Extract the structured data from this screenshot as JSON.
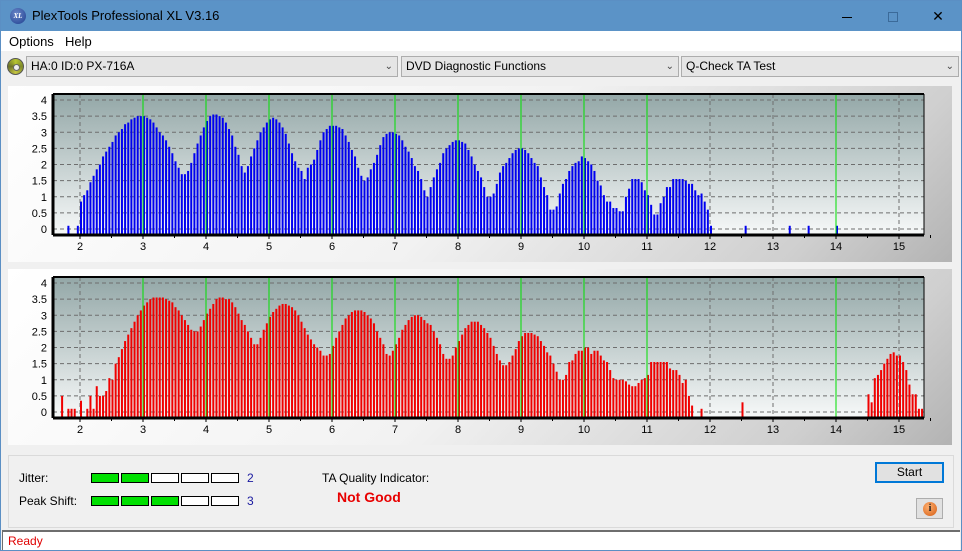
{
  "window": {
    "title": "PlexTools Professional XL V3.16",
    "app_icon_text": "XL",
    "minimize_icon": "minimize-icon",
    "maximize_icon": "maximize-icon",
    "close_glyph": "✕"
  },
  "menu": {
    "items": [
      {
        "label": "Options"
      },
      {
        "label": "Help"
      }
    ]
  },
  "toolbar": {
    "drive": {
      "value": "HA:0 ID:0  PX-716A",
      "icon": "disc-icon"
    },
    "function": {
      "value": "DVD Diagnostic Functions"
    },
    "test": {
      "value": "Q-Check TA Test"
    },
    "dropdown_arrow": "⌄"
  },
  "colors": {
    "top_series": "#0000f0",
    "bottom_series": "#f00000",
    "marker_lines": "#00e000",
    "meter_on": "#00e000",
    "quality_bad": "#e80000",
    "status_text": "#e00000"
  },
  "chart_data": [
    {
      "type": "bar",
      "title": "",
      "xlabel": "",
      "ylabel": "",
      "xlim": [
        1.65,
        15.4
      ],
      "ylim": [
        -0.15,
        4.15
      ],
      "x_ticks": [
        2,
        3,
        4,
        5,
        6,
        7,
        8,
        9,
        10,
        11,
        12,
        13,
        14,
        15
      ],
      "y_ticks": [
        0,
        0.5,
        1,
        1.5,
        2,
        2.5,
        3,
        3.5,
        4
      ],
      "y_tick_labels": [
        "0",
        "0.5",
        "1",
        "1.5",
        "2",
        "2.5",
        "3",
        "3.5",
        "4"
      ],
      "marker_lines": [
        3,
        4,
        5,
        6,
        7,
        8,
        9,
        10,
        11,
        14
      ],
      "grid": true,
      "series": [
        {
          "name": "top",
          "x_start": 1.8,
          "x_step": 0.05,
          "values": [
            0.1,
            0,
            0,
            0.1,
            0.85,
            1.05,
            1.2,
            1.45,
            1.65,
            1.85,
            2.0,
            2.25,
            2.4,
            2.55,
            2.7,
            2.9,
            3.0,
            3.1,
            3.25,
            3.3,
            3.4,
            3.45,
            3.5,
            3.5,
            3.5,
            3.45,
            3.4,
            3.3,
            3.15,
            3.0,
            2.9,
            2.75,
            2.55,
            2.35,
            2.1,
            1.9,
            1.7,
            1.7,
            1.8,
            2.05,
            2.35,
            2.65,
            2.9,
            3.15,
            3.35,
            3.5,
            3.55,
            3.55,
            3.5,
            3.45,
            3.3,
            3.1,
            2.9,
            2.55,
            2.3,
            1.95,
            1.75,
            1.95,
            2.25,
            2.5,
            2.75,
            3.0,
            3.15,
            3.3,
            3.4,
            3.45,
            3.4,
            3.3,
            3.15,
            2.95,
            2.65,
            2.35,
            2.1,
            1.9,
            1.8,
            1.55,
            1.9,
            2.0,
            2.15,
            2.45,
            2.75,
            3.0,
            3.1,
            3.2,
            3.2,
            3.2,
            3.15,
            3.1,
            2.9,
            2.7,
            2.45,
            2.25,
            1.9,
            1.65,
            1.5,
            1.6,
            1.85,
            2.05,
            2.3,
            2.6,
            2.85,
            2.95,
            3.0,
            3.0,
            2.95,
            2.9,
            2.75,
            2.55,
            2.4,
            2.2,
            1.95,
            1.8,
            1.55,
            1.2,
            1.0,
            1.3,
            1.6,
            1.85,
            2.05,
            2.35,
            2.5,
            2.6,
            2.7,
            2.75,
            2.75,
            2.7,
            2.65,
            2.45,
            2.25,
            2.0,
            1.8,
            1.6,
            1.3,
            1.0,
            1.0,
            1.1,
            1.4,
            1.75,
            1.95,
            2.05,
            2.2,
            2.35,
            2.45,
            2.5,
            2.5,
            2.45,
            2.35,
            2.2,
            2.05,
            1.95,
            1.6,
            1.3,
            1.05,
            0.6,
            0.6,
            0.7,
            1.1,
            1.4,
            1.55,
            1.8,
            1.95,
            2.05,
            2.1,
            2.25,
            2.2,
            2.1,
            2.0,
            1.8,
            1.5,
            1.35,
            1.05,
            0.85,
            0.85,
            0.65,
            0.65,
            0.55,
            0.55,
            1.0,
            1.25,
            1.55,
            1.55,
            1.55,
            1.45,
            1.2,
            1.05,
            0.75,
            0.45,
            0.45,
            0.8,
            1.0,
            1.3,
            1.3,
            1.55,
            1.55,
            1.55,
            1.55,
            1.5,
            1.4,
            1.4,
            1.2,
            1.05,
            1.1,
            0.85,
            0.6,
            0.1,
            0,
            0,
            0,
            0,
            0,
            0,
            0,
            0,
            0,
            0,
            0.1,
            0,
            0,
            0,
            0,
            0,
            0,
            0,
            0,
            0,
            0,
            0,
            0,
            0,
            0.1,
            0,
            0,
            0,
            0,
            0,
            0.1,
            0,
            0,
            0,
            0,
            0,
            0,
            0,
            0,
            0.1,
            0,
            0,
            0,
            0,
            0,
            0,
            0,
            0,
            0,
            0,
            0,
            0,
            0,
            0,
            0,
            0,
            0,
            0,
            0,
            0,
            0,
            0,
            0,
            0,
            0,
            0,
            0,
            0,
            0,
            0,
            0.55,
            0.1,
            0.7,
            0.55,
            1.0,
            1.25,
            1.45,
            1.6,
            1.6,
            1.65,
            1.5,
            1.6,
            1.45,
            1.35,
            1.4,
            1.15,
            1.0,
            0.7,
            0.1,
            0.1,
            0,
            0.1
          ]
        }
      ]
    },
    {
      "type": "bar",
      "title": "",
      "xlabel": "",
      "ylabel": "",
      "xlim": [
        1.65,
        15.4
      ],
      "ylim": [
        -0.15,
        4.15
      ],
      "x_ticks": [
        2,
        3,
        4,
        5,
        6,
        7,
        8,
        9,
        10,
        11,
        12,
        13,
        14,
        15
      ],
      "y_ticks": [
        0,
        0.5,
        1,
        1.5,
        2,
        2.5,
        3,
        3.5,
        4
      ],
      "y_tick_labels": [
        "0",
        "0.5",
        "1",
        "1.5",
        "2",
        "2.5",
        "3",
        "3.5",
        "4"
      ],
      "marker_lines": [
        3,
        4,
        5,
        6,
        7,
        8,
        9,
        10,
        11,
        14
      ],
      "grid": true,
      "series": [
        {
          "name": "bottom",
          "x_start": 1.7,
          "x_step": 0.05,
          "values": [
            0.5,
            0,
            0.1,
            0.1,
            0.1,
            0,
            0.35,
            0,
            0.1,
            0.5,
            0.1,
            0.8,
            0.5,
            0.5,
            0.65,
            1.05,
            1.0,
            1.5,
            1.7,
            1.95,
            2.2,
            2.4,
            2.6,
            2.8,
            3.0,
            3.15,
            3.3,
            3.4,
            3.5,
            3.55,
            3.55,
            3.55,
            3.55,
            3.5,
            3.45,
            3.4,
            3.25,
            3.15,
            3.0,
            2.85,
            2.7,
            2.55,
            2.5,
            2.5,
            2.65,
            2.85,
            3.05,
            3.2,
            3.35,
            3.5,
            3.55,
            3.55,
            3.5,
            3.5,
            3.4,
            3.25,
            3.05,
            2.85,
            2.7,
            2.5,
            2.3,
            2.1,
            2.1,
            2.3,
            2.55,
            2.75,
            2.95,
            3.1,
            3.2,
            3.3,
            3.35,
            3.35,
            3.3,
            3.25,
            3.15,
            3.0,
            2.8,
            2.6,
            2.4,
            2.25,
            2.1,
            2.0,
            1.9,
            1.75,
            1.75,
            1.8,
            2.05,
            2.3,
            2.5,
            2.7,
            2.9,
            3.0,
            3.1,
            3.15,
            3.15,
            3.15,
            3.1,
            3.0,
            2.9,
            2.75,
            2.5,
            2.3,
            2.1,
            1.8,
            1.75,
            1.9,
            2.1,
            2.3,
            2.55,
            2.7,
            2.85,
            2.95,
            3.0,
            3.0,
            2.95,
            2.85,
            2.75,
            2.7,
            2.5,
            2.3,
            2.1,
            1.8,
            1.65,
            1.65,
            1.75,
            2.0,
            2.2,
            2.4,
            2.6,
            2.7,
            2.8,
            2.8,
            2.8,
            2.7,
            2.6,
            2.45,
            2.3,
            2.05,
            1.8,
            1.6,
            1.45,
            1.45,
            1.55,
            1.75,
            1.95,
            2.2,
            2.35,
            2.45,
            2.45,
            2.45,
            2.4,
            2.35,
            2.2,
            2.05,
            1.85,
            1.75,
            1.5,
            1.25,
            1.0,
            1.0,
            1.15,
            1.55,
            1.6,
            1.8,
            1.9,
            1.9,
            2.0,
            2.0,
            1.8,
            1.9,
            1.9,
            1.75,
            1.6,
            1.55,
            1.3,
            1.05,
            1.0,
            1.0,
            1.0,
            0.95,
            0.85,
            0.8,
            0.8,
            0.9,
            1.0,
            1.05,
            1.15,
            1.55,
            1.55,
            1.55,
            1.55,
            1.55,
            1.55,
            1.35,
            1.3,
            1.3,
            1.15,
            0.9,
            1.0,
            0.5,
            0.2,
            0,
            0,
            0.1,
            0,
            0,
            0,
            0,
            0,
            0,
            0,
            0,
            0,
            0,
            0,
            0,
            0.3,
            0,
            0,
            0,
            0,
            0,
            0,
            0,
            0,
            0,
            0,
            0,
            0,
            0,
            0,
            0,
            0,
            0,
            0,
            0,
            0,
            0,
            0,
            0,
            0,
            0,
            0,
            0,
            0,
            0,
            0,
            0,
            0,
            0,
            0,
            0,
            0,
            0,
            0,
            0,
            0.55,
            0.3,
            1.05,
            1.15,
            1.3,
            1.5,
            1.65,
            1.8,
            1.85,
            1.75,
            1.75,
            1.55,
            1.3,
            0.85,
            0.55,
            0.55,
            0.1,
            0.1,
            0,
            0,
            0,
            0,
            0,
            0,
            0,
            0.1
          ]
        }
      ]
    }
  ],
  "bottom_panel": {
    "jitter": {
      "label": "Jitter:",
      "value": "2",
      "filled": 2,
      "segments": 5
    },
    "peak_shift": {
      "label": "Peak Shift:",
      "value": "3",
      "filled": 3,
      "segments": 5
    },
    "quality": {
      "label": "TA Quality Indicator:",
      "value": "Not Good"
    },
    "start_label": "Start",
    "info_glyph": "i"
  },
  "status": {
    "text": "Ready"
  }
}
